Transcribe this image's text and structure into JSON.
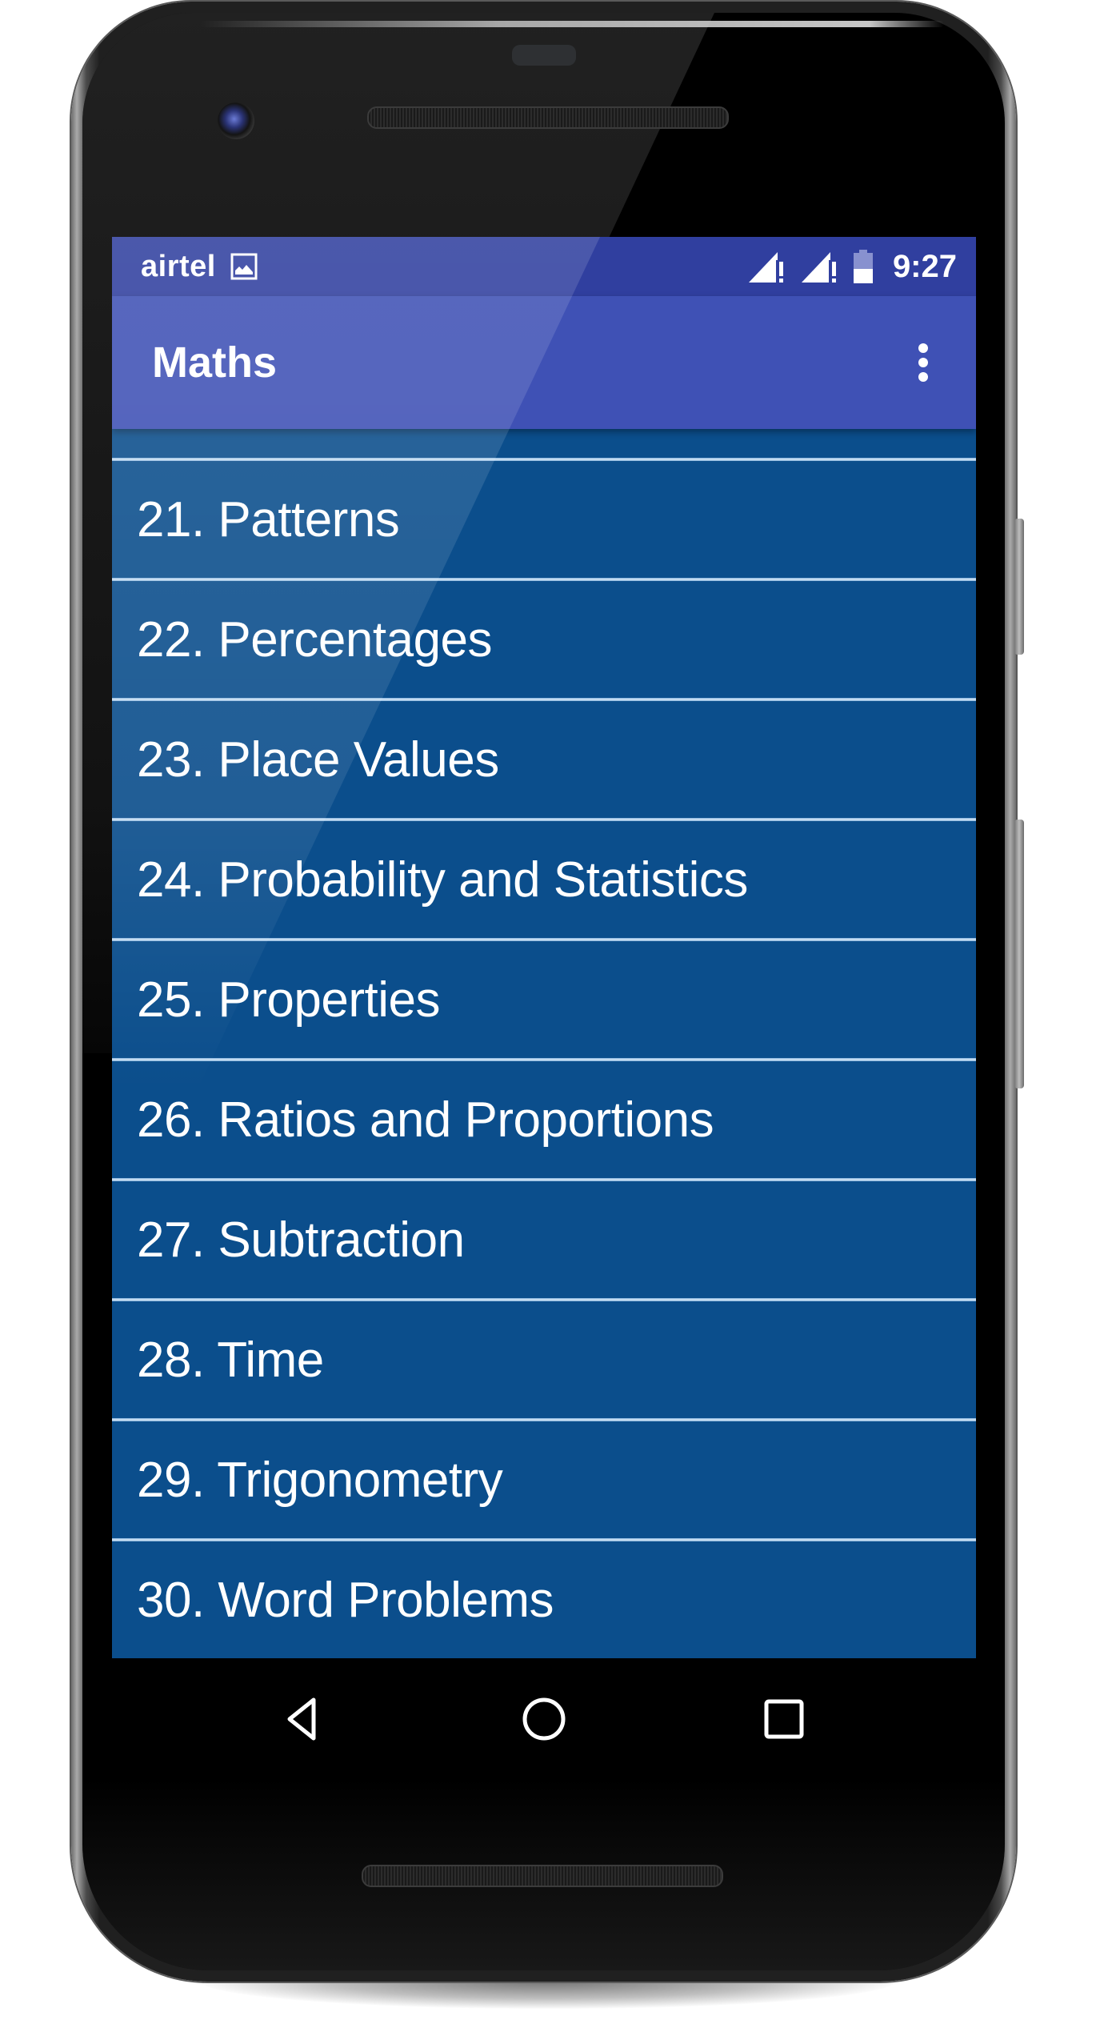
{
  "status_bar": {
    "carrier": "airtel",
    "notification_icon": "image-icon",
    "signal_icons": [
      "signal-warning-icon",
      "signal-warning-icon"
    ],
    "battery_icon": "battery-half-icon",
    "battery_level_percent": 50,
    "time": "9:27"
  },
  "app_bar": {
    "title": "Maths",
    "overflow_icon": "more-vert-icon"
  },
  "topics": [
    {
      "number": "21.",
      "label": "21. Patterns"
    },
    {
      "number": "22.",
      "label": "22. Percentages"
    },
    {
      "number": "23.",
      "label": "23. Place Values"
    },
    {
      "number": "24.",
      "label": "24. Probability and Statistics"
    },
    {
      "number": "25.",
      "label": "25. Properties"
    },
    {
      "number": "26.",
      "label": "26. Ratios and Proportions"
    },
    {
      "number": "27.",
      "label": "27. Subtraction"
    },
    {
      "number": "28.",
      "label": "28. Time"
    },
    {
      "number": "29.",
      "label": "29. Trigonometry"
    },
    {
      "number": "30.",
      "label": "30. Word Problems"
    }
  ],
  "nav_bar": {
    "back_icon": "back-triangle-icon",
    "home_icon": "home-circle-icon",
    "recents_icon": "recents-square-icon"
  },
  "colors": {
    "status_bar": "#303f9f",
    "app_bar": "#3f51b5",
    "list_background": "#0b4e8c",
    "divider": "#b7d3ee",
    "text": "#ffffff",
    "nav_bar": "#000000"
  }
}
